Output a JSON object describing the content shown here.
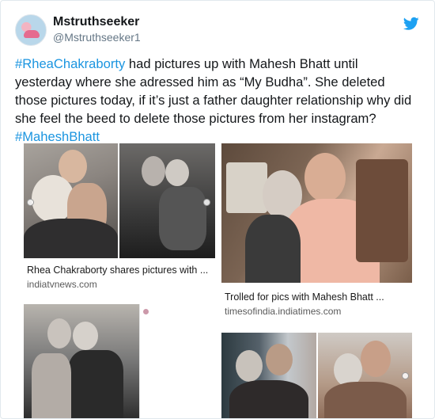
{
  "tweet": {
    "display_name": "Mstruthseeker",
    "handle": "@Mstruthseeker1",
    "text_parts": [
      {
        "t": "#RheaChakraborty",
        "tag": true
      },
      {
        "t": " had pictures up with Mahesh Bhatt until yesterday where she adressed him as “My Budha”. She deleted those pictures today, if it’s just a father daughter relationship why did she feel the beed to delete those pictures from her instagram? ",
        "tag": false
      },
      {
        "t": "#MaheshBhatt",
        "tag": true
      }
    ],
    "brand_color": "#1da1f2"
  },
  "results": [
    {
      "caption": "Rhea Chakraborty shares pictures with ...",
      "source": "indiatvnews.com"
    },
    {
      "caption": "Trolled for pics with Mahesh Bhatt ...",
      "source": "timesofindia.indiatimes.com"
    },
    {
      "caption": "",
      "source": ""
    },
    {
      "caption": "",
      "source": ""
    }
  ],
  "icons": {
    "bird": "twitter-bird-icon",
    "avatar": "profile-avatar"
  }
}
